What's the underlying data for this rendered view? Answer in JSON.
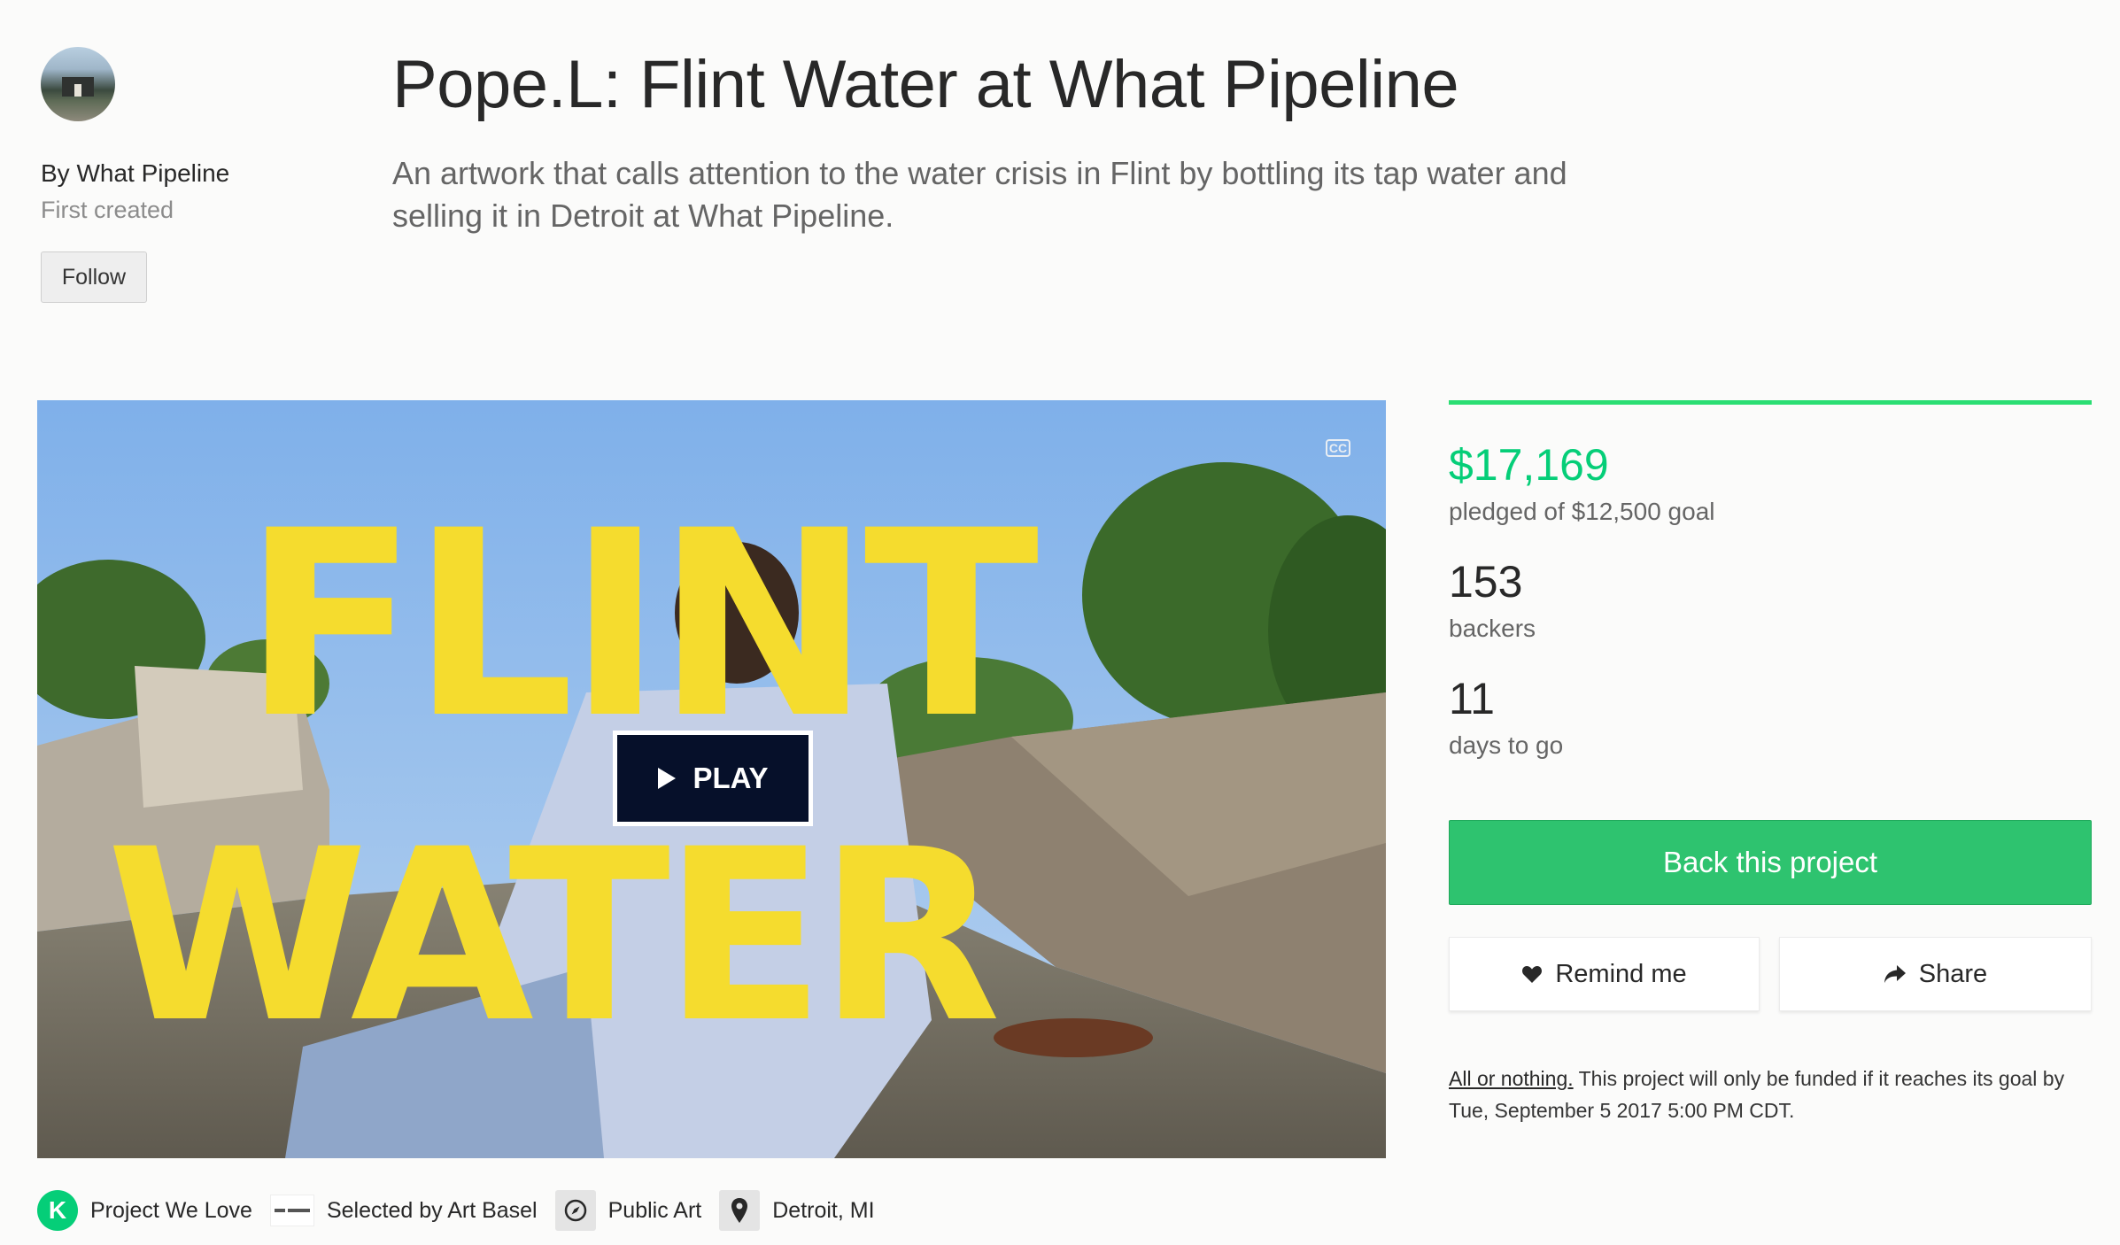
{
  "creator": {
    "by_prefix": "By",
    "name": "What Pipeline",
    "subtitle": "First created",
    "follow_label": "Follow"
  },
  "project": {
    "title": "Pope.L: Flint Water at What Pipeline",
    "blurb": "An artwork that calls attention to the water crisis in Flint by bottling its tap water and selling it in Detroit at What Pipeline."
  },
  "video": {
    "overlay_line1": "FLINT",
    "overlay_line2": "WATER",
    "play_label": "PLAY",
    "cc_label": "CC",
    "overlay_color": "#f5dc2e"
  },
  "stats": {
    "progress_fraction": 1.0,
    "pledged": "$17,169",
    "pledged_sub": "pledged of $12,500 goal",
    "backers": "153",
    "backers_sub": "backers",
    "days": "11",
    "days_sub": "days to go",
    "accent_color": "#05ce78"
  },
  "actions": {
    "back_label": "Back this project",
    "remind_label": "Remind me",
    "share_label": "Share"
  },
  "funding_note": {
    "link_text": "All or nothing.",
    "text": "This project will only be funded if it reaches its goal by Tue, September 5 2017 5:00 PM CDT."
  },
  "tags": {
    "project_we_love": "Project We Love",
    "k_letter": "K",
    "selected_prefix": "Selected by",
    "selected_by": "Art Basel",
    "category": "Public Art",
    "location": "Detroit, MI"
  }
}
